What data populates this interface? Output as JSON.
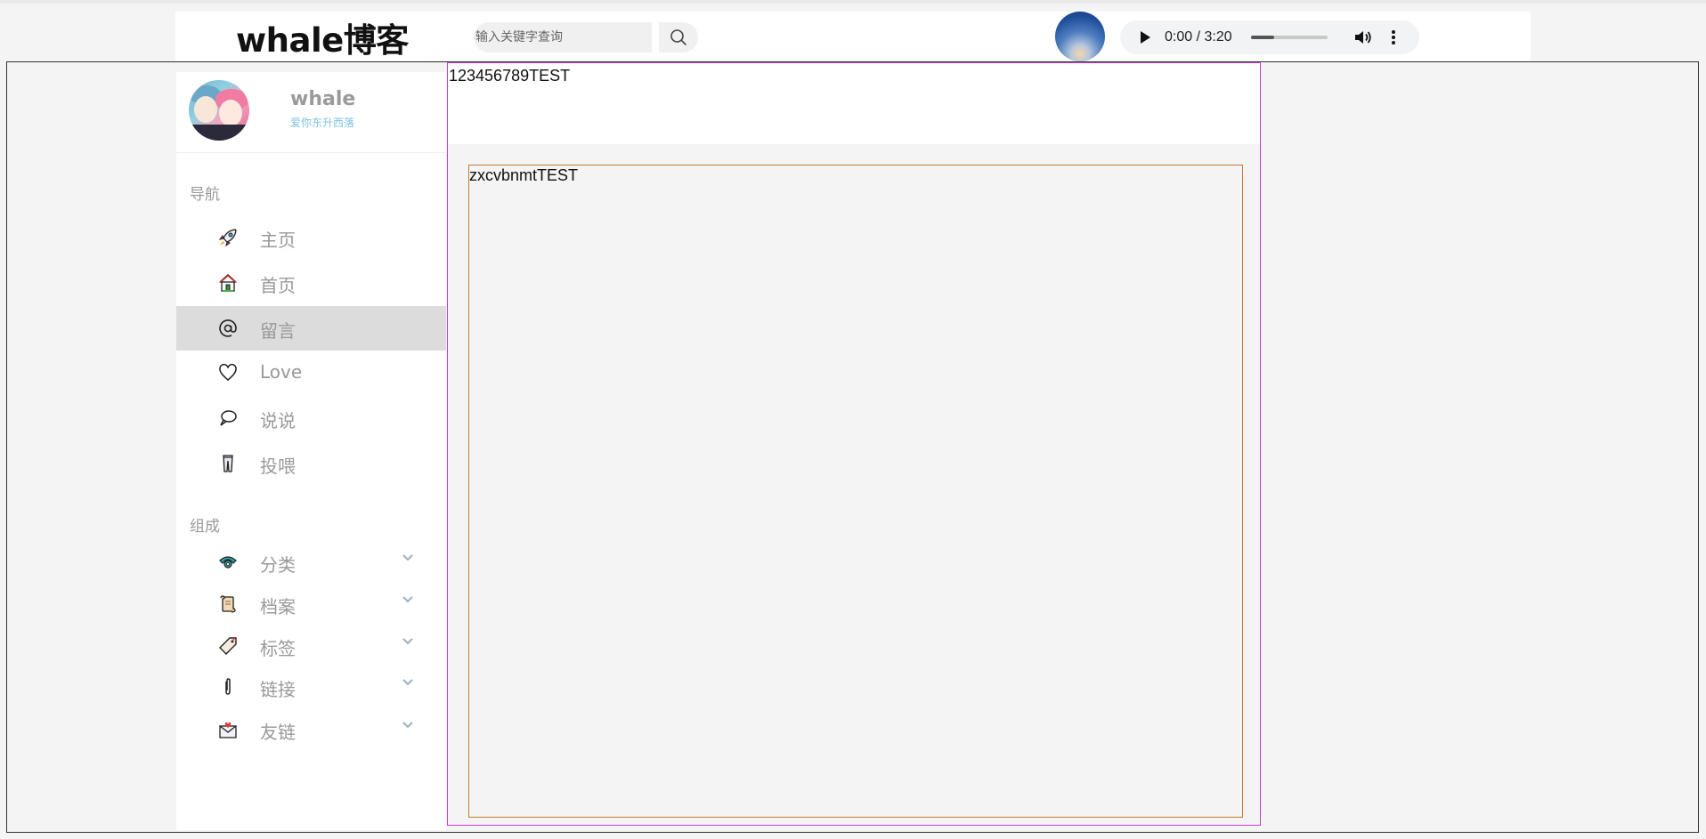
{
  "header": {
    "brand": "whale博客",
    "search_placeholder": "输入关键字查询"
  },
  "player": {
    "time": "0:00 / 3:20",
    "progress_fraction": 0.3
  },
  "profile": {
    "name": "whale",
    "motto": "爱你东升西落"
  },
  "sidebar": {
    "nav_title": "导航",
    "nav_items": [
      {
        "label": "主页",
        "icon": "rocket-icon"
      },
      {
        "label": "首页",
        "icon": "house-icon"
      },
      {
        "label": "留言",
        "icon": "at-icon",
        "active": true
      },
      {
        "label": "Love",
        "icon": "heart-icon"
      },
      {
        "label": "说说",
        "icon": "speech-bubble-icon"
      },
      {
        "label": "投喂",
        "icon": "trousers-icon"
      }
    ],
    "compose_title": "组成",
    "compose_items": [
      {
        "label": "分类",
        "icon": "telephone-icon"
      },
      {
        "label": "档案",
        "icon": "scroll-icon"
      },
      {
        "label": "标签",
        "icon": "tag-icon"
      },
      {
        "label": "链接",
        "icon": "paperclip-icon"
      },
      {
        "label": "友链",
        "icon": "love-letter-icon"
      }
    ]
  },
  "content": {
    "banner_text": "123456789TEST",
    "inner_text": "zxcvbnmtTEST"
  },
  "colors": {
    "content_border": "#c43bd7",
    "inner_border": "#c57b2d",
    "active_nav": "#dcdcdc",
    "motto": "#7fc3e0"
  }
}
